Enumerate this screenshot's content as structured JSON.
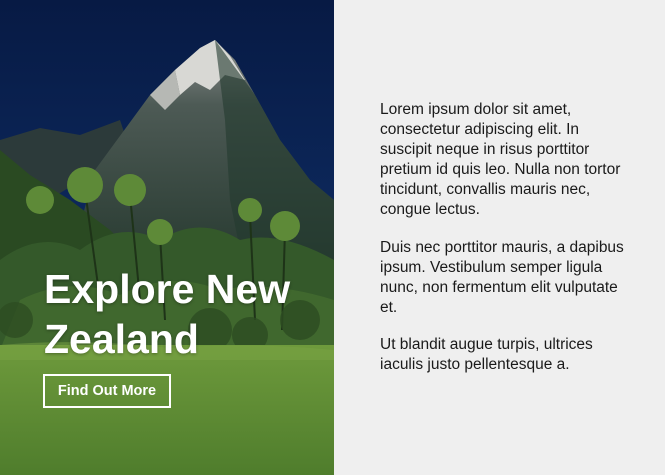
{
  "hero": {
    "title": "Explore New Zealand",
    "button_label": "Find Out More"
  },
  "content": {
    "paragraphs": [
      "Lorem ipsum dolor sit amet, consectetur adipiscing elit. In suscipit neque in risus porttitor pretium id quis leo. Nulla non tortor tincidunt, convallis mauris nec, congue lectus.",
      "Duis nec porttitor mauris, a dapibus ipsum. Vestibulum semper ligula nunc, non fermentum elit vulputate et.",
      "Ut blandit augue turpis, ultrices iaculis justo pellentesque a."
    ]
  },
  "colors": {
    "sky": "#0b1f4a",
    "mountain": "#3a4a44",
    "grass": "#5d8a36",
    "panel_background": "#efefef",
    "text": "#1a1a1a",
    "hero_text": "#ffffff"
  }
}
